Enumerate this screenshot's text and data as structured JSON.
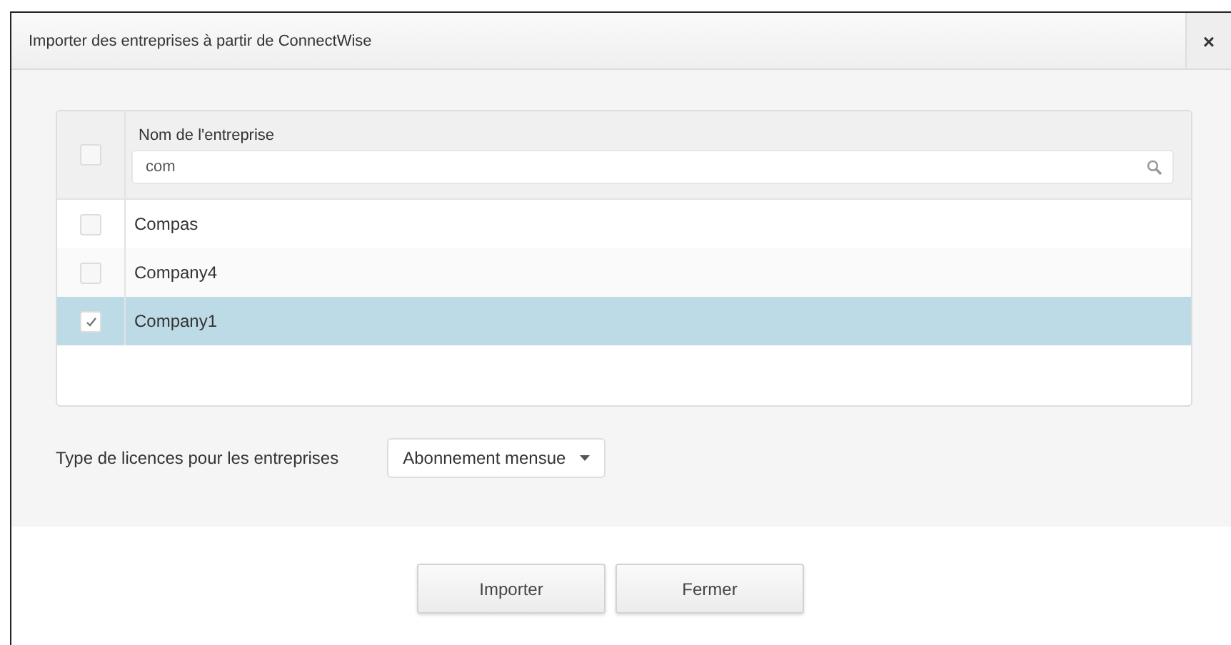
{
  "dialog": {
    "title": "Importer des entreprises à partir de ConnectWise",
    "close": "×"
  },
  "table": {
    "select_all": {
      "checked": false
    },
    "column": "Nom de l'entreprise",
    "filter": {
      "value": "com"
    },
    "rows": [
      {
        "name": "Compas",
        "checked": false,
        "selected": false
      },
      {
        "name": "Company4",
        "checked": false,
        "selected": false
      },
      {
        "name": "Company1",
        "checked": true,
        "selected": true
      }
    ]
  },
  "license": {
    "label": "Type de licences pour les entreprises",
    "value": "Abonnement mensue"
  },
  "buttons": [
    "Importer",
    "Fermer"
  ]
}
